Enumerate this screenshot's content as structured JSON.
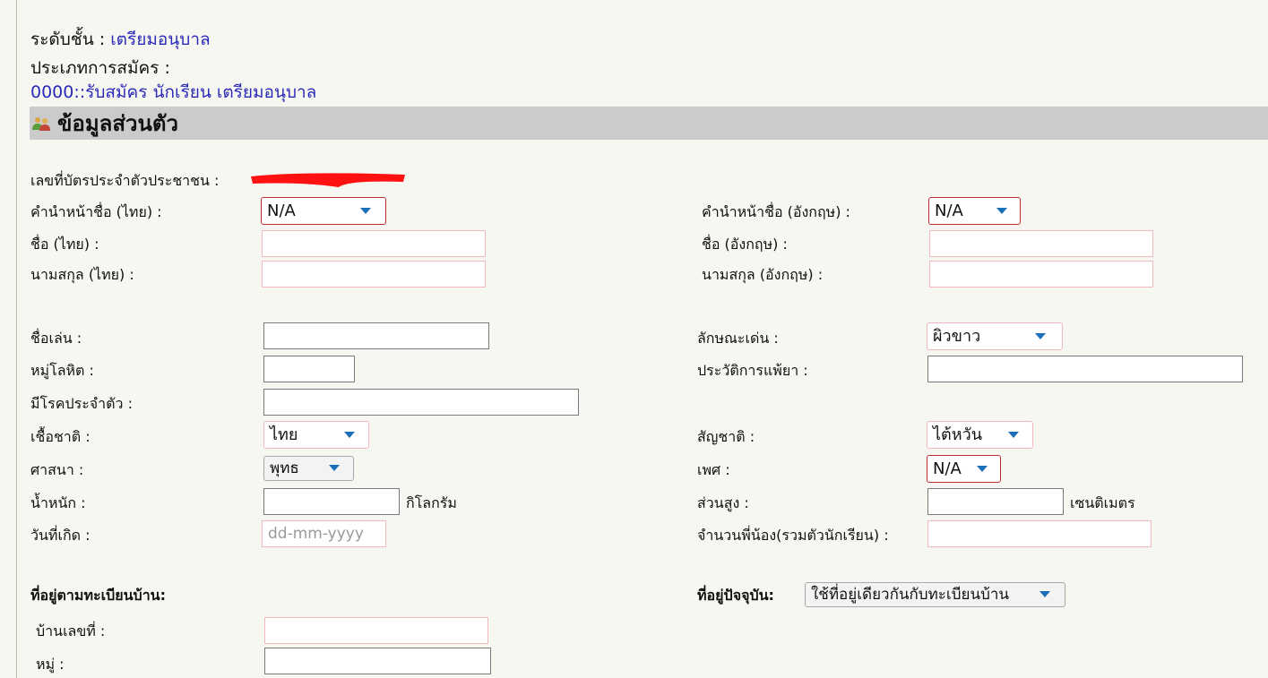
{
  "level": {
    "label": "ระดับชั้น :",
    "value": "เตรียมอนุบาล"
  },
  "apply_type": {
    "label": "ประเภทการสมัคร :",
    "value": "0000::รับสมัคร นักเรียน เตรียมอนุบาล"
  },
  "section_title": "ข้อมูลส่วนตัว",
  "id_card": {
    "label": "เลขที่บัตรประจำตัวประชาชน :"
  },
  "prefix_th": {
    "label": "คำนำหน้าชื่อ (ไทย) :",
    "value": "N/A"
  },
  "prefix_en": {
    "label": "คำนำหน้าชื่อ (อังกฤษ) :",
    "value": "N/A"
  },
  "first_th": {
    "label": "ชื่อ (ไทย) :",
    "value": ""
  },
  "first_en": {
    "label": "ชื่อ (อังกฤษ) :",
    "value": ""
  },
  "last_th": {
    "label": "นามสกุล (ไทย) :",
    "value": ""
  },
  "last_en": {
    "label": "นามสกุล (อังกฤษ) :",
    "value": ""
  },
  "nickname": {
    "label": "ชื่อเล่น :",
    "value": ""
  },
  "feature": {
    "label": "ลักษณะเด่น :",
    "value": "ผิวขาว"
  },
  "blood": {
    "label": "หมู่โลหิต :",
    "value": ""
  },
  "allergy": {
    "label": "ประวัติการแพ้ยา :",
    "value": ""
  },
  "disease": {
    "label": "มีโรคประจำตัว :",
    "value": ""
  },
  "race": {
    "label": "เชื้อชาติ :",
    "value": "ไทย"
  },
  "nationality": {
    "label": "สัญชาติ :",
    "value": "ไต้หวัน"
  },
  "religion": {
    "label": "ศาสนา :",
    "value": "พุทธ"
  },
  "sex": {
    "label": "เพศ :",
    "value": "N/A"
  },
  "weight": {
    "label": "น้ำหนัก :",
    "value": "",
    "unit": "กิโลกรัม"
  },
  "height": {
    "label": "ส่วนสูง :",
    "value": "",
    "unit": "เซนติเมตร"
  },
  "birthdate": {
    "label": "วันที่เกิด :",
    "placeholder": "dd-mm-yyyy"
  },
  "siblings": {
    "label": "จำนวนพี่น้อง(รวมตัวนักเรียน) :",
    "value": ""
  },
  "reg_address": {
    "title": "ที่อยู่ตามทะเบียนบ้าน:"
  },
  "current_address": {
    "title": "ที่อยู่ปัจจุบัน:",
    "value": "ใช้ที่อยู่เดียวกันกับทะเบียนบ้าน"
  },
  "house_no": {
    "label": "บ้านเลขที่ :",
    "value": ""
  },
  "moo": {
    "label": "หมู่ :",
    "value": ""
  },
  "colors": {
    "link_blue": "#2a2ab8",
    "header_bar": "#cbcbcb",
    "caret_blue": "#1b6fb8",
    "required_red": "#c22a2a"
  }
}
